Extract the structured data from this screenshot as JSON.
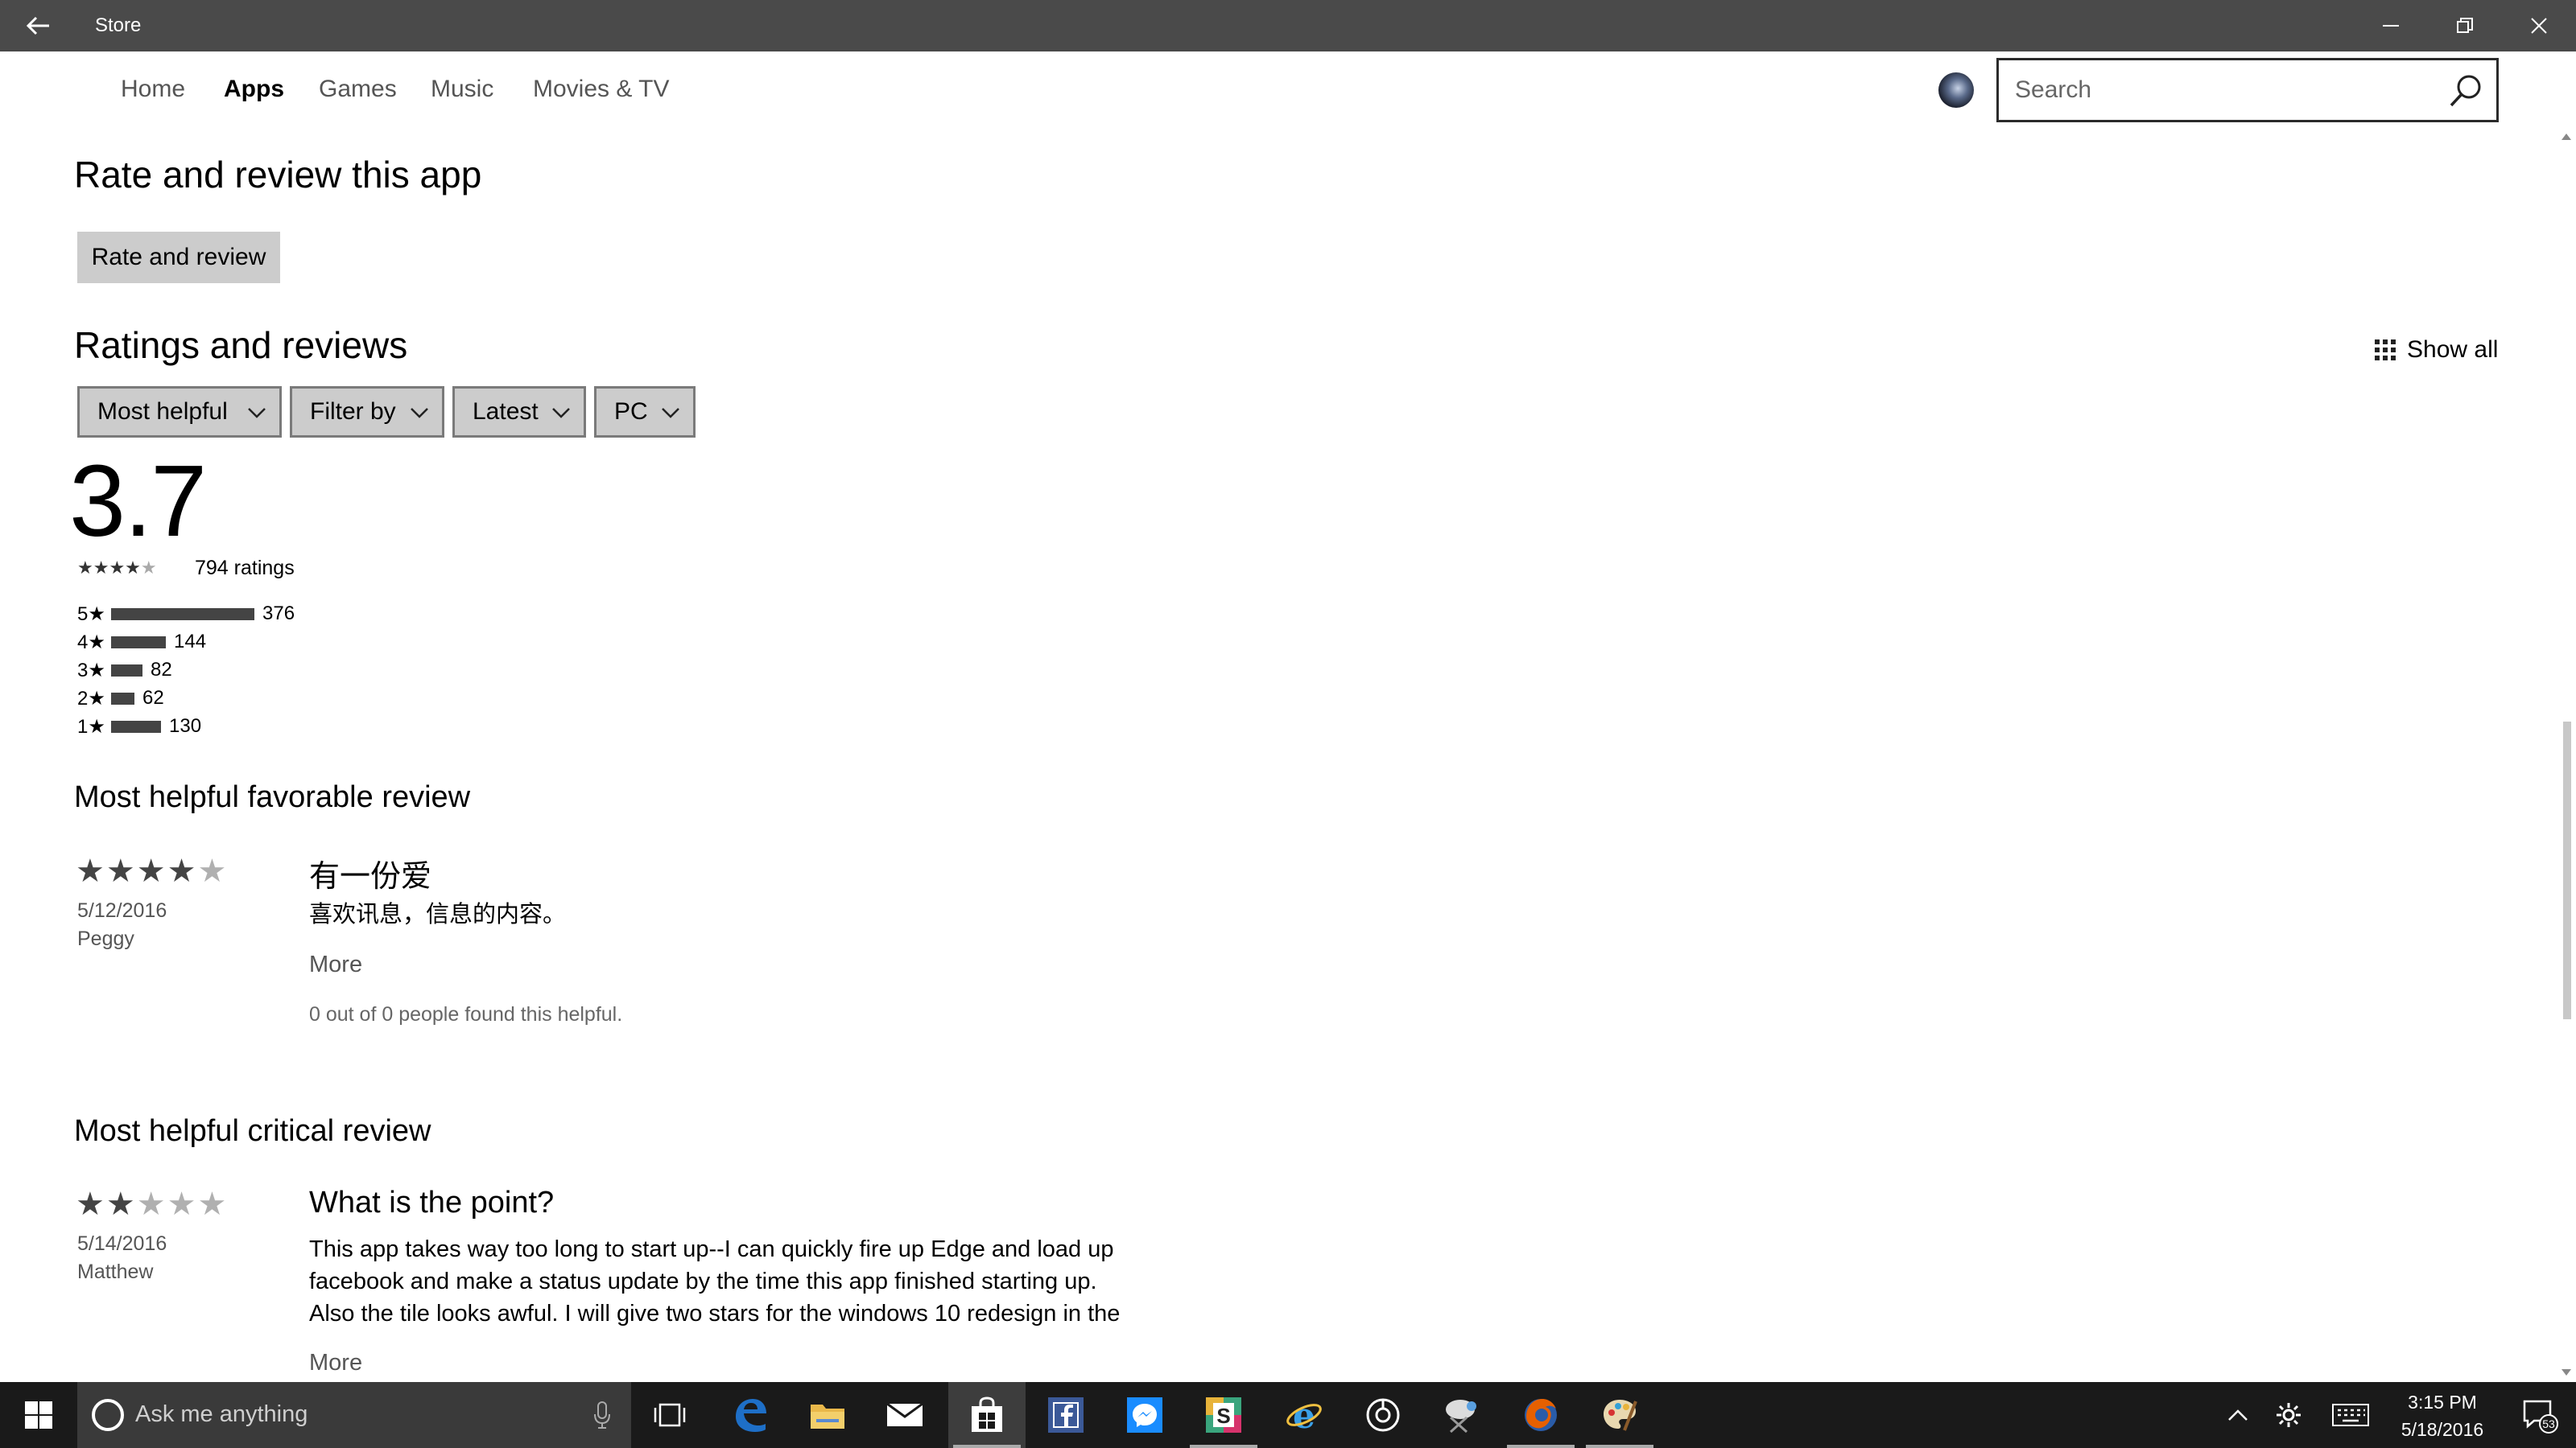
{
  "window": {
    "title": "Store"
  },
  "nav": {
    "tabs": [
      {
        "label": "Home",
        "active": false
      },
      {
        "label": "Apps",
        "active": true
      },
      {
        "label": "Games",
        "active": false
      },
      {
        "label": "Music",
        "active": false
      },
      {
        "label": "Movies & TV",
        "active": false
      }
    ],
    "search_placeholder": "Search"
  },
  "rate_section": {
    "heading": "Rate and review this app",
    "button_label": "Rate and review"
  },
  "ratings_section": {
    "heading": "Ratings and reviews",
    "show_all_label": "Show all",
    "filters": [
      "Most helpful",
      "Filter by",
      "Latest",
      "PC"
    ],
    "average": "3.7",
    "average_stars": 3.7,
    "ratings_count_label": "794 ratings",
    "histogram": [
      {
        "label": "5★",
        "count": 376
      },
      {
        "label": "4★",
        "count": 144
      },
      {
        "label": "3★",
        "count": 82
      },
      {
        "label": "2★",
        "count": 62
      },
      {
        "label": "1★",
        "count": 130
      }
    ]
  },
  "favorable_review": {
    "heading": "Most helpful favorable review",
    "stars": 4,
    "date": "5/12/2016",
    "author": "Peggy",
    "title": "有一份爱",
    "body": "喜欢讯息，信息的内容。",
    "more_label": "More",
    "helpful_text": "0 out of 0 people found this helpful."
  },
  "critical_review": {
    "heading": "Most helpful critical review",
    "stars": 2,
    "date": "5/14/2016",
    "author": "Matthew",
    "title": "What is the point?",
    "body_lines": [
      "This app takes way too long to start up--I can quickly fire up Edge and load up",
      "facebook and make a status update by the time this app finished starting up.",
      "Also the tile looks awful. I will give two stars for the windows 10 redesign in the"
    ],
    "more_label": "More"
  },
  "taskbar": {
    "cortana_placeholder": "Ask me anything",
    "clock_time": "3:15 PM",
    "clock_date": "5/18/2016",
    "notification_count": "53"
  },
  "colors": {
    "titlebar": "#4a4a4a",
    "taskbar": "#1a1a1a",
    "button_gray": "#cccccc",
    "edge_blue": "#1e6fc7",
    "facebook_blue": "#3b5998",
    "messenger_blue": "#1a8cff",
    "firefox_orange": "#e66000"
  }
}
